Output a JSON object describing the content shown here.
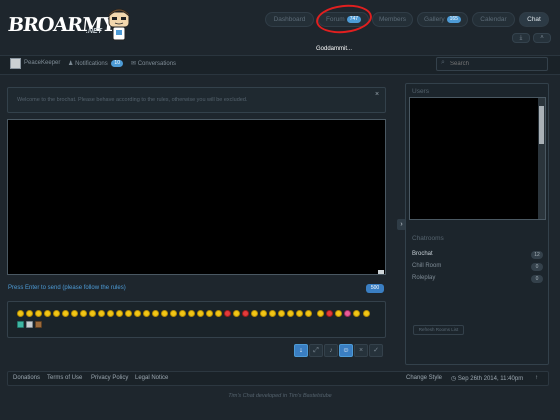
{
  "logo": {
    "text": "BROARMY",
    "suffix": ".NET"
  },
  "nav": {
    "tabs": [
      {
        "label": "Dashboard"
      },
      {
        "label": "Forum",
        "badge": "747"
      },
      {
        "label": "Members"
      },
      {
        "label": "Gallery",
        "badge": "165"
      },
      {
        "label": "Calendar"
      },
      {
        "label": "Chat",
        "active": true
      }
    ]
  },
  "annotation": {
    "text": "Goddammit..."
  },
  "userbar": {
    "username": "PeaceKeeper",
    "notifications_label": "Notifications",
    "notifications_count": "10",
    "conversations_label": "Conversations"
  },
  "search": {
    "placeholder": "Search"
  },
  "chat": {
    "notice": "Welcome to the brochat. Please behave according to the rules, otherwise you will be excluded.",
    "send_hint": "Press Enter to send (please follow the rules)",
    "char_count": "500"
  },
  "sidebar": {
    "users_title": "Users",
    "chatrooms_title": "Chatrooms",
    "rooms": [
      {
        "name": "Brochat",
        "count": "12",
        "active": true
      },
      {
        "name": "Chill Room",
        "count": "0",
        "active": false
      },
      {
        "name": "Roleplay",
        "count": "0",
        "active": false
      }
    ],
    "refresh_label": "Refresh Rooms List"
  },
  "footer": {
    "links": [
      "Donations",
      "Terms of Use",
      "Privacy Policy",
      "Legal Notice"
    ],
    "change_style": "Change Style",
    "datetime": "Sep 26th 2014, 11:40pm"
  },
  "credit": {
    "product": "Tim's Chat",
    "developed_in": "developed in",
    "studio": "Tim's Bastelstube"
  },
  "colors": {
    "accent": "#4d9bd6",
    "annotation": "#e11f1f",
    "background": "#1e262d"
  }
}
